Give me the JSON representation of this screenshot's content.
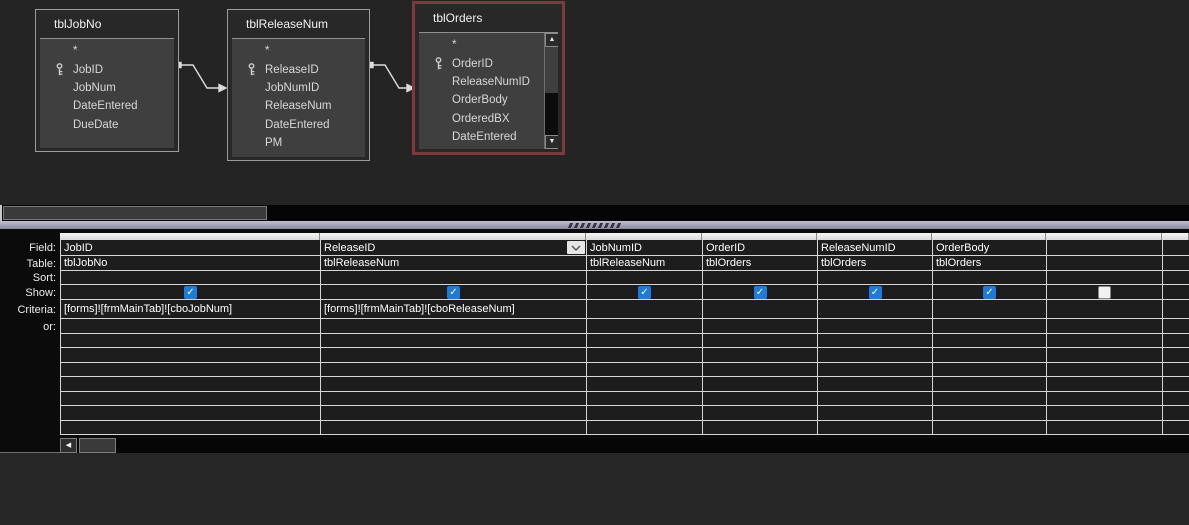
{
  "diagram": {
    "tables": [
      {
        "name": "tblJobNo",
        "selected": false,
        "scrollbar": false,
        "fields": [
          {
            "name": "*",
            "key": false
          },
          {
            "name": "JobID",
            "key": true
          },
          {
            "name": "JobNum",
            "key": false
          },
          {
            "name": "DateEntered",
            "key": false
          },
          {
            "name": "DueDate",
            "key": false
          }
        ]
      },
      {
        "name": "tblReleaseNum",
        "selected": false,
        "scrollbar": false,
        "fields": [
          {
            "name": "*",
            "key": false
          },
          {
            "name": "ReleaseID",
            "key": true
          },
          {
            "name": "JobNumID",
            "key": false
          },
          {
            "name": "ReleaseNum",
            "key": false
          },
          {
            "name": "DateEntered",
            "key": false
          },
          {
            "name": "PM",
            "key": false
          }
        ]
      },
      {
        "name": "tblOrders",
        "selected": true,
        "scrollbar": true,
        "fields": [
          {
            "name": "*",
            "key": false
          },
          {
            "name": "OrderID",
            "key": true
          },
          {
            "name": "ReleaseNumID",
            "key": false
          },
          {
            "name": "OrderBody",
            "key": false
          },
          {
            "name": "OrderedBX",
            "key": false
          },
          {
            "name": "DateEntered",
            "key": false
          }
        ]
      }
    ]
  },
  "grid": {
    "row_labels": [
      "Field:",
      "Table:",
      "Sort:",
      "Show:",
      "Criteria:",
      "or:"
    ],
    "empty_rows": 7,
    "columns": [
      {
        "field": "JobID",
        "table": "tblJobNo",
        "sort": "",
        "show": "checked",
        "criteria": "[forms]![frmMainTab]![cboJobNum]",
        "or": "",
        "dropdown": false
      },
      {
        "field": "ReleaseID",
        "table": "tblReleaseNum",
        "sort": "",
        "show": "checked",
        "criteria": "[forms]![frmMainTab]![cboReleaseNum]",
        "or": "",
        "dropdown": true
      },
      {
        "field": "JobNumID",
        "table": "tblReleaseNum",
        "sort": "",
        "show": "checked",
        "criteria": "",
        "or": "",
        "dropdown": false
      },
      {
        "field": "OrderID",
        "table": "tblOrders",
        "sort": "",
        "show": "checked",
        "criteria": "",
        "or": "",
        "dropdown": false
      },
      {
        "field": "ReleaseNumID",
        "table": "tblOrders",
        "sort": "",
        "show": "checked",
        "criteria": "",
        "or": "",
        "dropdown": false
      },
      {
        "field": "OrderBody",
        "table": "tblOrders",
        "sort": "",
        "show": "checked",
        "criteria": "",
        "or": "",
        "dropdown": false
      },
      {
        "field": "",
        "table": "",
        "sort": "",
        "show": "unchecked",
        "criteria": "",
        "or": "",
        "dropdown": false
      },
      {
        "field": "",
        "table": "",
        "sort": "",
        "show": "none",
        "criteria": "",
        "or": "",
        "dropdown": false
      }
    ]
  },
  "colors": {
    "check_blue": "#1e7bd7",
    "selected_table_border": "#7e3a3a",
    "splitter": "#a9a7c0",
    "gridline": "#d6d6d6"
  }
}
